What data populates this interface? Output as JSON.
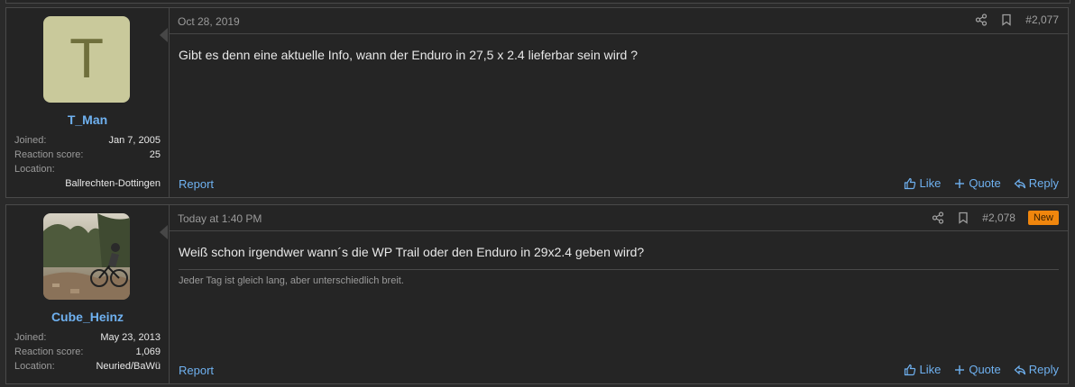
{
  "posts": [
    {
      "avatar_letter": "T",
      "username": "T_Man",
      "joined_label": "Joined:",
      "joined": "Jan 7, 2005",
      "reaction_label": "Reaction score:",
      "reaction": "25",
      "location_label": "Location:",
      "location": "Ballrechten-Dottingen",
      "date": "Oct 28, 2019",
      "number": "#2,077",
      "message": "Gibt es denn eine aktuelle Info, wann der Enduro in 27,5 x 2.4 lieferbar sein wird ?",
      "report": "Report",
      "like": "Like",
      "quote": "Quote",
      "reply": "Reply"
    },
    {
      "username": "Cube_Heinz",
      "joined_label": "Joined:",
      "joined": "May 23, 2013",
      "reaction_label": "Reaction score:",
      "reaction": "1,069",
      "location_label": "Location:",
      "location": "Neuried/BaWü",
      "date": "Today at 1:40 PM",
      "number": "#2,078",
      "badge": "New",
      "message": "Weiß schon irgendwer wann´s die WP Trail oder den Enduro in 29x2.4 geben wird?",
      "signature": "Jeder Tag ist gleich lang, aber unterschiedlich breit.",
      "report": "Report",
      "like": "Like",
      "quote": "Quote",
      "reply": "Reply"
    }
  ],
  "icons": {
    "share": "share-icon",
    "bookmark": "bookmark-icon",
    "like": "thumbs-up-icon",
    "quote": "plus-icon",
    "reply": "reply-arrow-icon"
  },
  "colors": {
    "link": "#6fb1f0",
    "badge_new": "#f0860d",
    "avatar_bg": "#c9c99b"
  }
}
